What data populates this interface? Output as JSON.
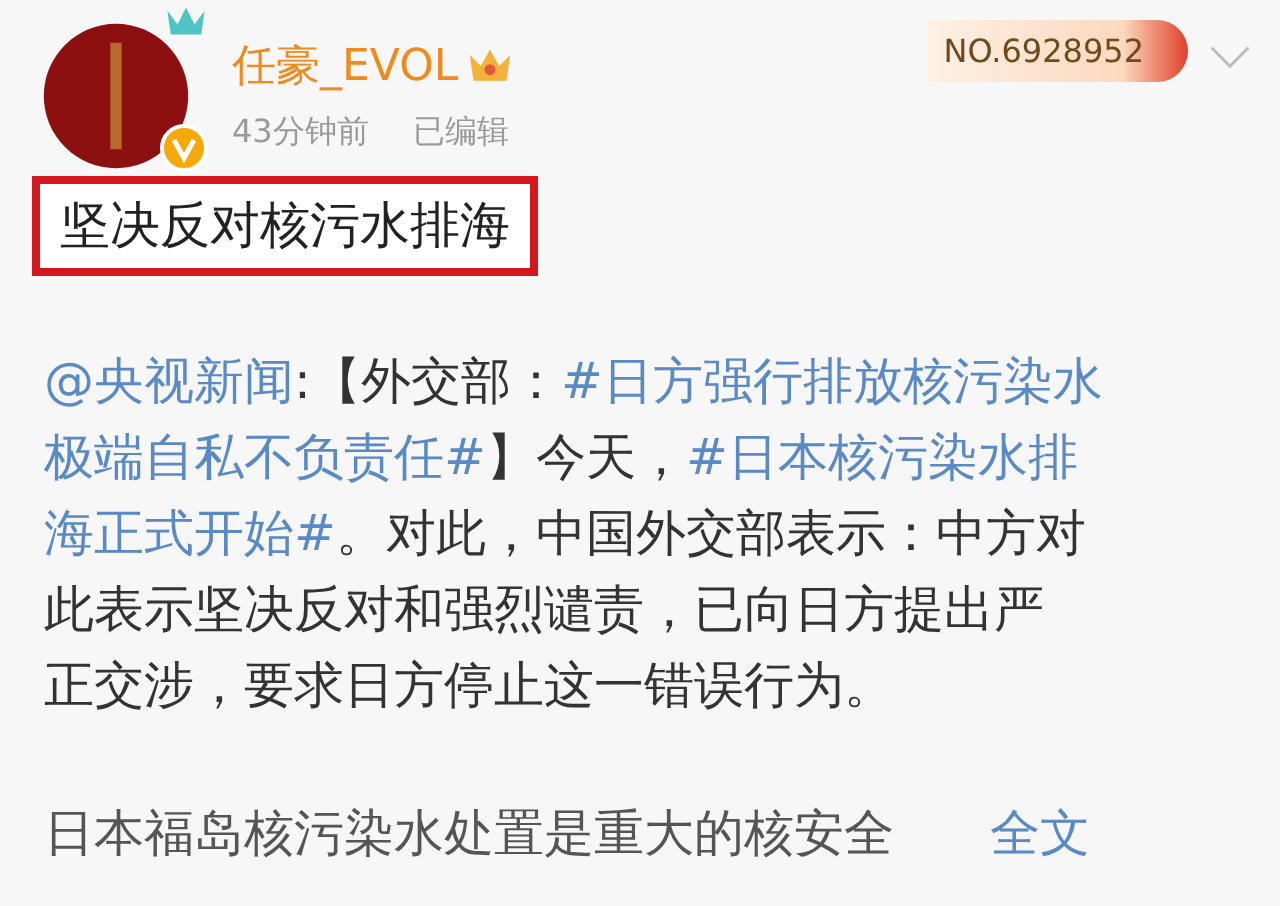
{
  "post": {
    "author": "任豪_EVOL",
    "verified": true,
    "time": "43分钟前",
    "edited": "已编辑",
    "badge_number": "NO.6928952",
    "title": "坚决反对核污水排海",
    "lines": [
      [
        {
          "kind": "link",
          "text": "@央视新闻"
        },
        {
          "kind": "text",
          "text": ":【外交部："
        },
        {
          "kind": "link",
          "text": "#日方强行排放核污染水"
        }
      ],
      [
        {
          "kind": "link",
          "text": "极端自私不负责任#"
        },
        {
          "kind": "text",
          "text": "】今天，"
        },
        {
          "kind": "link",
          "text": "#日本核污染水排"
        }
      ],
      [
        {
          "kind": "link",
          "text": "海正式开始#"
        },
        {
          "kind": "text",
          "text": "。对此，中国外交部表示：中方对"
        }
      ],
      [
        {
          "kind": "text",
          "text": "此表示坚决反对和强烈谴责，已向日方提出严"
        }
      ],
      [
        {
          "kind": "text",
          "text": "正交涉，要求日方停止这一错误行为。"
        }
      ]
    ],
    "last_line": "日本福岛核污染水处置是重大的核安全",
    "more": "全文"
  }
}
